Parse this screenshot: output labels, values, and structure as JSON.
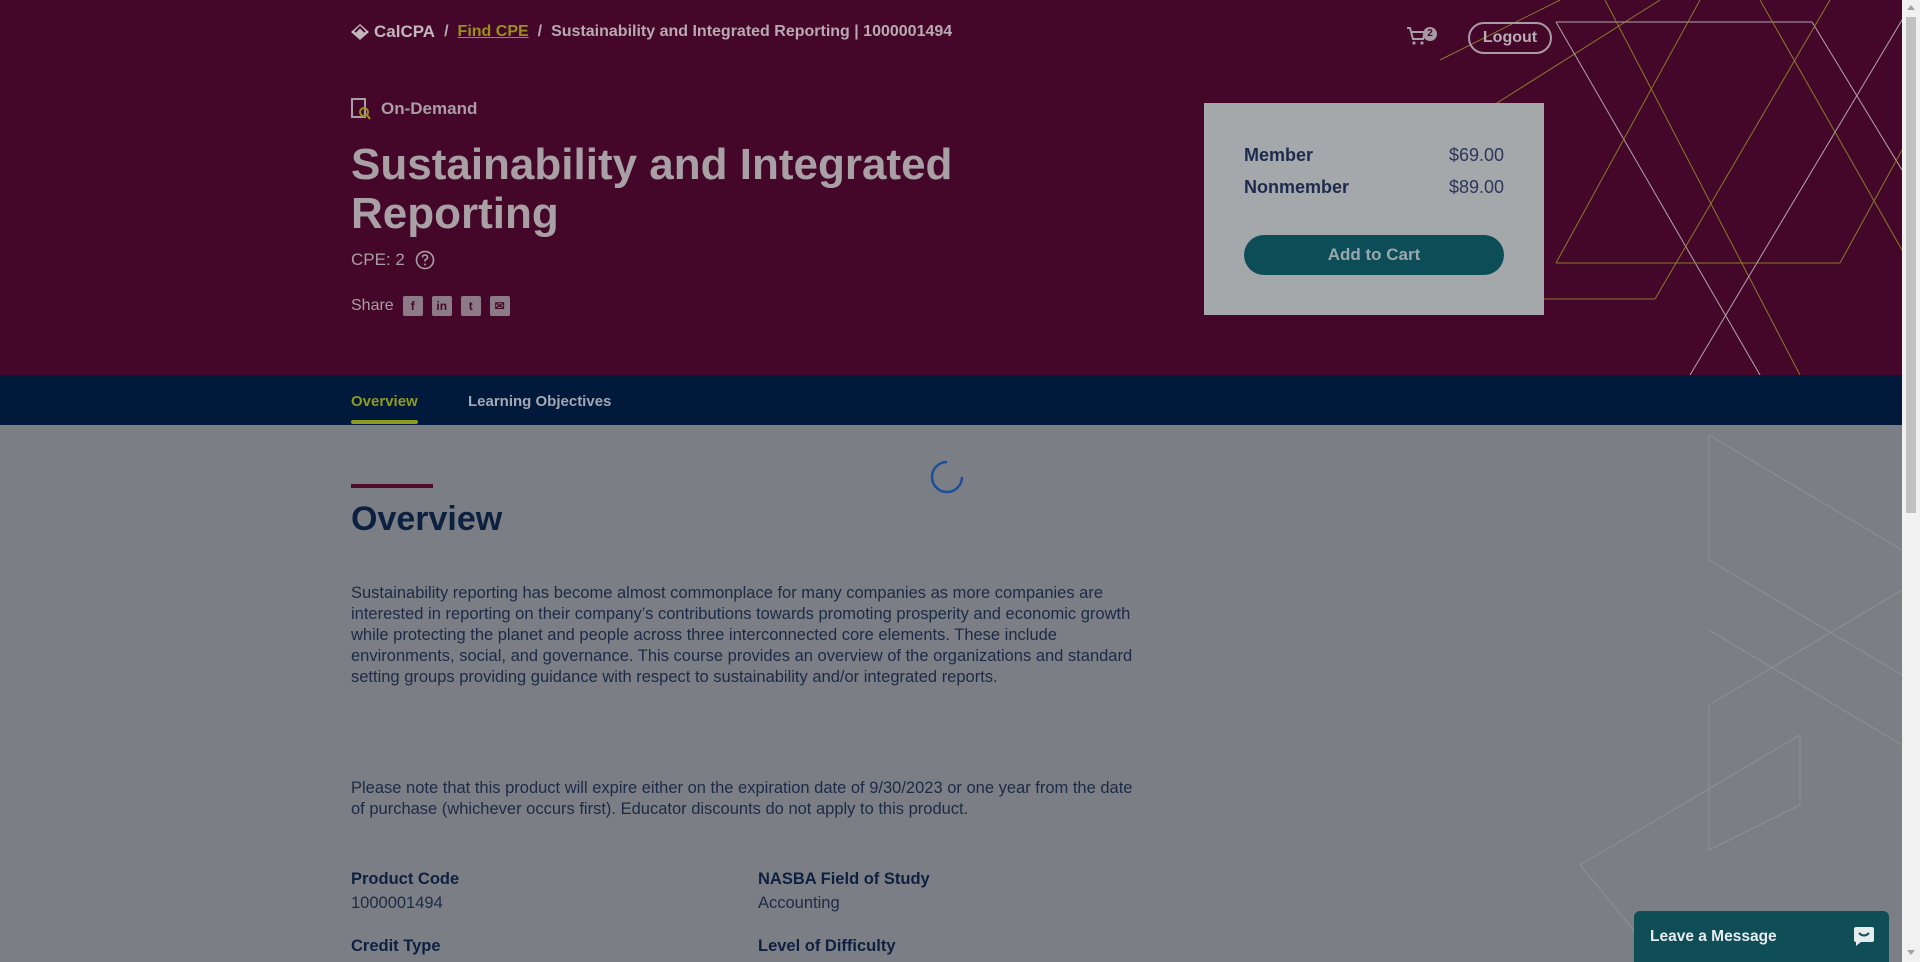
{
  "header": {
    "logo_text": "CalCPA",
    "breadcrumb": {
      "sep": "/",
      "find_cpe": "Find CPE",
      "current": "Sustainability and Integrated Reporting | 1000001494"
    },
    "cart_count": "2",
    "logout_label": "Logout"
  },
  "hero": {
    "format_label": "On-Demand",
    "title": "Sustainability and Integrated Reporting",
    "cpe_label": "CPE: 2",
    "share_label": "Share"
  },
  "pricing": {
    "member_label": "Member",
    "member_price": "$69.00",
    "nonmember_label": "Nonmember",
    "nonmember_price": "$89.00",
    "add_to_cart_label": "Add to Cart"
  },
  "tabs": [
    {
      "label": "Overview",
      "active": true
    },
    {
      "label": "Learning Objectives",
      "active": false
    }
  ],
  "overview": {
    "heading": "Overview",
    "paragraph1": "Sustainability reporting has become almost commonplace for many companies as more companies are interested in reporting on their company’s contributions towards promoting prosperity and economic growth while protecting the planet and people across three interconnected core elements. These include environments, social, and governance. This course provides an overview of the organizations and standard setting groups providing guidance with respect to sustainability and/or integrated reports.",
    "paragraph2": "Please note that this product will expire either on the expiration date of 9/30/2023 or one year from the date of purchase (whichever occurs first). Educator discounts do not apply to this product.",
    "product_code_label": "Product Code",
    "product_code": "1000001494",
    "field_of_study_label": "NASBA Field of Study",
    "field_of_study": "Accounting",
    "credit_type_label": "Credit Type",
    "difficulty_label": "Level of Difficulty"
  },
  "chat": {
    "label": "Leave a Message"
  },
  "colors": {
    "hero_bg": "#440729",
    "tabbar_bg": "#011a3c",
    "accent": "#8f9a20",
    "button_bg": "#0d4d57"
  }
}
